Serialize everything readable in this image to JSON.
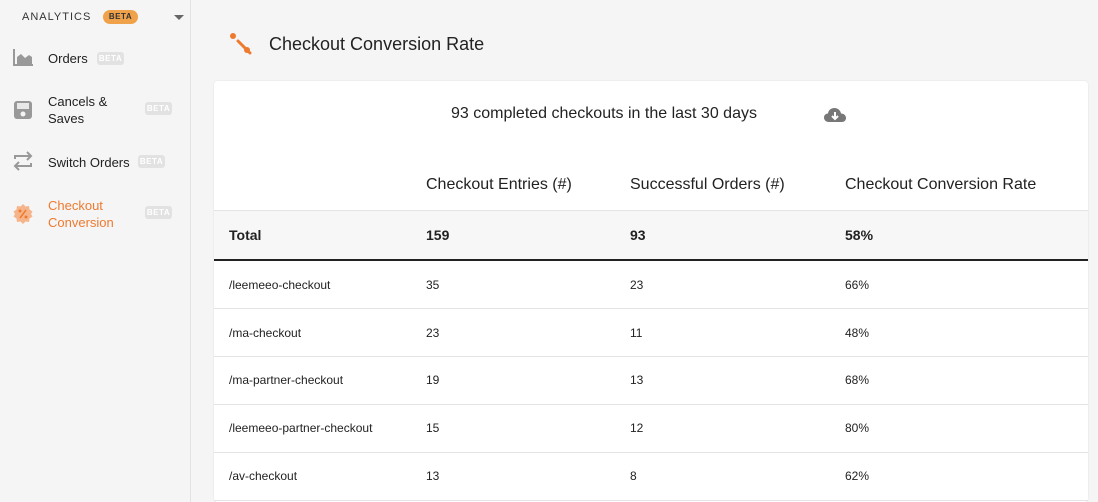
{
  "sidebar": {
    "section_title": "ANALYTICS",
    "section_badge": "BETA",
    "items": [
      {
        "label": "Orders",
        "badge": "BETA",
        "icon": "area-chart-icon"
      },
      {
        "label": "Cancels & Saves",
        "badge": "BETA",
        "icon": "floppy-disk-icon"
      },
      {
        "label": "Switch Orders",
        "badge": "BETA",
        "icon": "switch-arrows-icon"
      },
      {
        "label": "Checkout Conversion",
        "badge": "BETA",
        "icon": "percent-badge-icon",
        "active": true
      }
    ]
  },
  "header": {
    "title": "Checkout Conversion Rate",
    "icon": "percent-icon"
  },
  "card": {
    "summary": "93 completed checkouts in the last 30 days",
    "download_icon": "cloud-download-icon"
  },
  "table": {
    "columns": [
      "",
      "Checkout Entries (#)",
      "Successful Orders (#)",
      "Checkout Conversion Rate"
    ],
    "total": {
      "label": "Total",
      "entries": "159",
      "orders": "93",
      "rate": "58%"
    },
    "rows": [
      {
        "path": "/leemeeo-checkout",
        "entries": "35",
        "orders": "23",
        "rate": "66%"
      },
      {
        "path": "/ma-checkout",
        "entries": "23",
        "orders": "11",
        "rate": "48%"
      },
      {
        "path": "/ma-partner-checkout",
        "entries": "19",
        "orders": "13",
        "rate": "68%"
      },
      {
        "path": "/leemeeo-partner-checkout",
        "entries": "15",
        "orders": "12",
        "rate": "80%"
      },
      {
        "path": "/av-checkout",
        "entries": "13",
        "orders": "8",
        "rate": "62%"
      }
    ]
  },
  "colors": {
    "accent": "#ee7a30",
    "beta_badge": "#f0a24a",
    "badge_gray": "#e2e2e2"
  }
}
